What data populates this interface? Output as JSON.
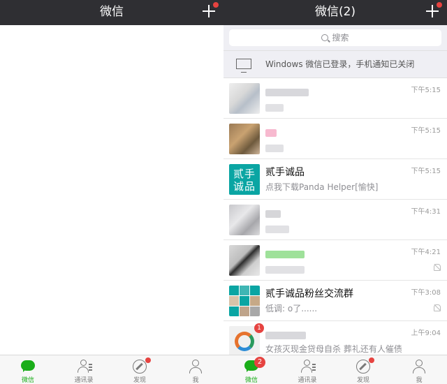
{
  "left": {
    "title": "微信",
    "tabs": [
      {
        "label": "微信",
        "icon": "chat-icon",
        "active": true
      },
      {
        "label": "通讯录",
        "icon": "contacts-icon"
      },
      {
        "label": "发现",
        "icon": "compass-icon",
        "dot": true
      },
      {
        "label": "我",
        "icon": "profile-icon"
      }
    ]
  },
  "right": {
    "title": "微信(2)",
    "search_placeholder": "搜索",
    "notice": "Windows 微信已登录，手机通知已关闭",
    "chats": [
      {
        "name": "",
        "preview": "",
        "time": "下午5:15",
        "avatar": "blurred"
      },
      {
        "name": "",
        "preview": "",
        "time": "下午5:15",
        "avatar": "blurred"
      },
      {
        "name": "贰手诚品",
        "preview": "点我下载Panda Helper[愉快]",
        "time": "下午5:15",
        "avatar_text": "贰手诚品"
      },
      {
        "name": "",
        "preview": "",
        "time": "下午4:31",
        "avatar": "blurred"
      },
      {
        "name": "",
        "preview": "",
        "time": "下午4:21",
        "muted": true,
        "avatar": "blurred"
      },
      {
        "name": "贰手诚品粉丝交流群",
        "preview": "低调: o了......",
        "time": "下午3:08",
        "muted": true,
        "avatar": "group-grid"
      },
      {
        "name": "",
        "preview": "女孩灭现金贷母自杀 葬礼还有人催债",
        "time": "上午9:04",
        "badge": "1",
        "avatar": "blurred"
      }
    ],
    "tabs": [
      {
        "label": "微信",
        "icon": "chat-icon",
        "active": true,
        "badge": "2"
      },
      {
        "label": "通讯录",
        "icon": "contacts-icon"
      },
      {
        "label": "发现",
        "icon": "compass-icon",
        "dot": true
      },
      {
        "label": "我",
        "icon": "profile-icon"
      }
    ]
  },
  "colors": {
    "topbar": "#2f2f33",
    "accent": "#1aad19",
    "badge": "#e64340",
    "brand": "#0aa5a3"
  }
}
